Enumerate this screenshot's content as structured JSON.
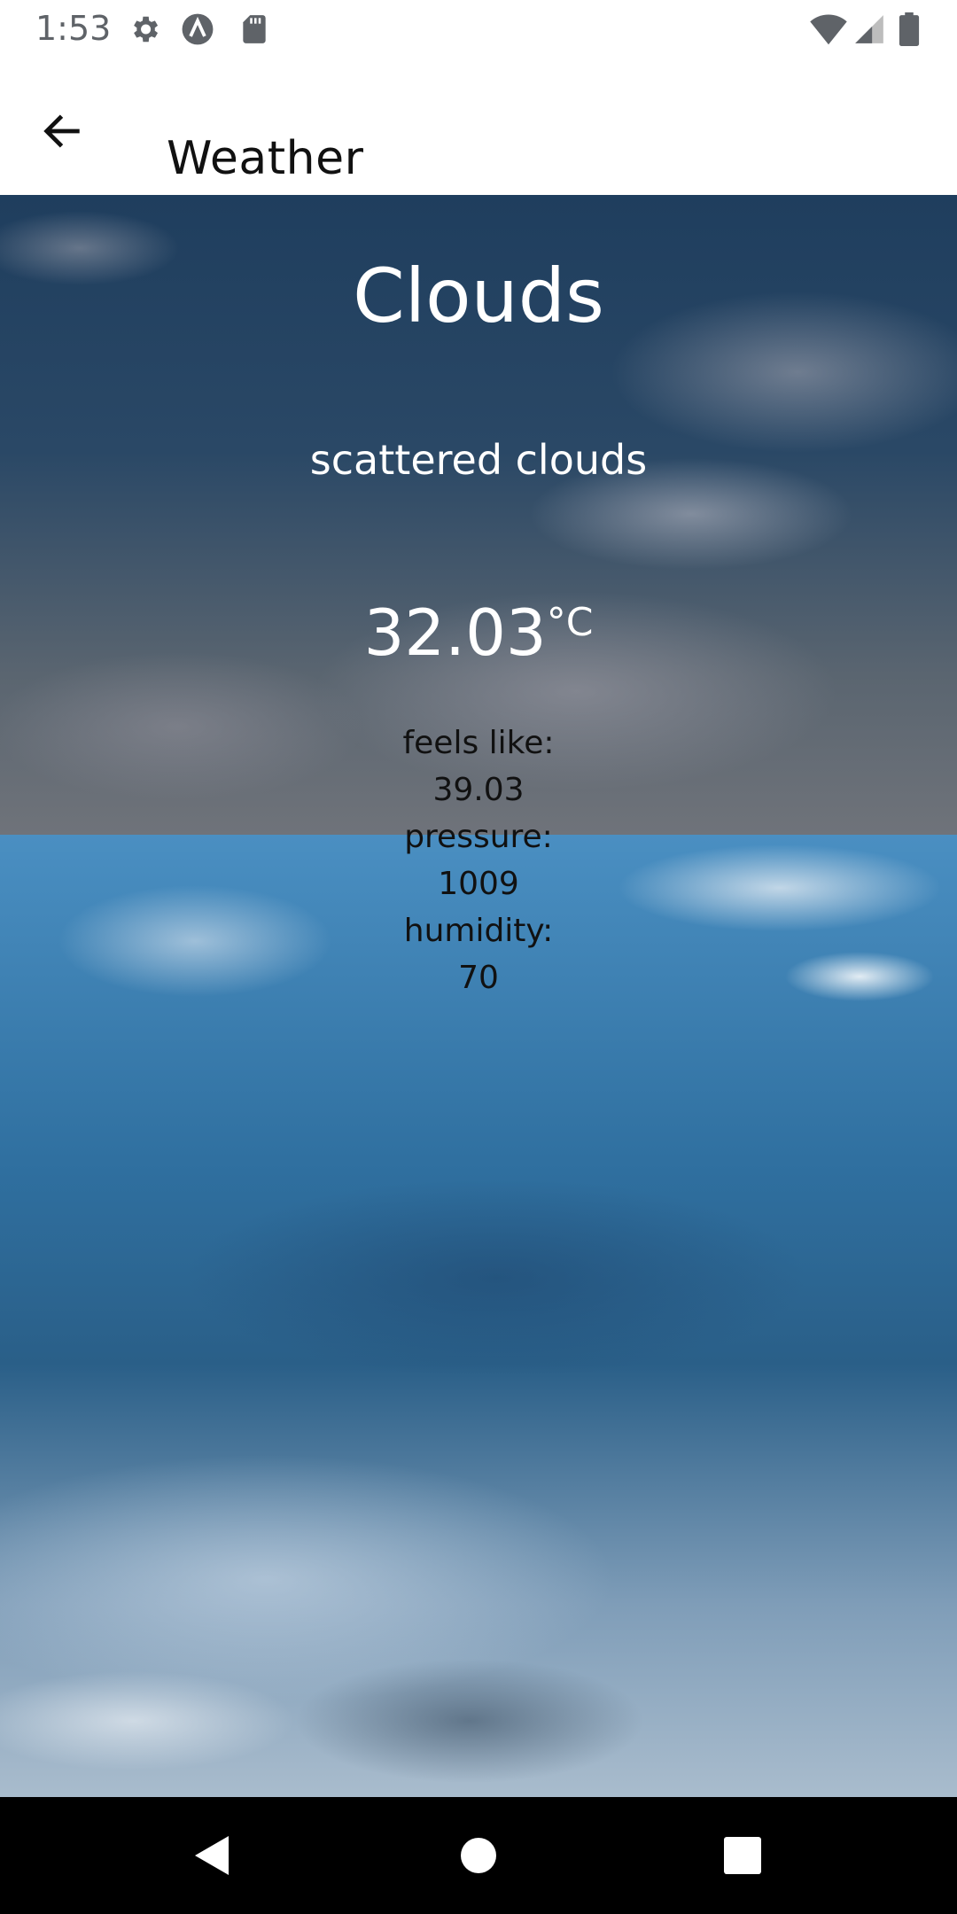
{
  "status_bar": {
    "time": "1:53"
  },
  "app_bar": {
    "title": "Weather"
  },
  "weather": {
    "main": "Clouds",
    "description": "scattered clouds",
    "temperature": "32.03",
    "unit": "°C",
    "feels_like_label": "feels like:",
    "feels_like_value": "39.03",
    "pressure_label": "pressure:",
    "pressure_value": "1009",
    "humidity_label": "humidity:",
    "humidity_value": "70"
  },
  "icons": {
    "status": [
      "settings-icon",
      "app-icon",
      "sd-card-icon",
      "wifi-icon",
      "signal-icon",
      "battery-icon"
    ],
    "app_bar": "back-arrow-icon",
    "nav": [
      "nav-back-icon",
      "nav-home-icon",
      "nav-recents-icon"
    ]
  }
}
